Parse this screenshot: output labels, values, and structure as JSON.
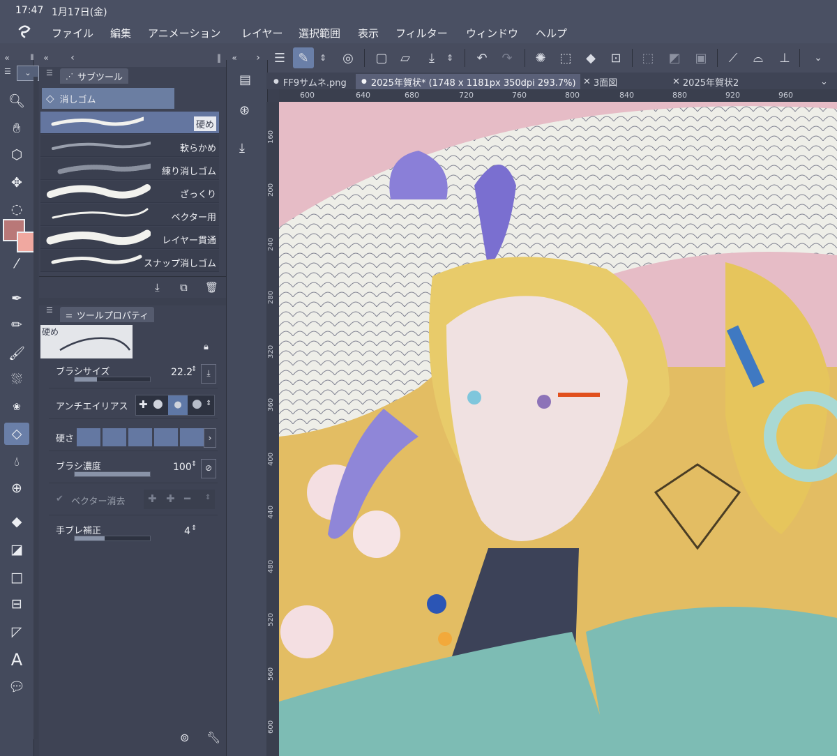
{
  "status": {
    "time": "17:47",
    "date": "1月17日(金)"
  },
  "menu": [
    "ファイル",
    "編集",
    "アニメーション",
    "レイヤー",
    "選択範囲",
    "表示",
    "フィルター",
    "ウィンドウ",
    "ヘルプ"
  ],
  "tabs": [
    {
      "label": "FF9サムネ.png",
      "active": false
    },
    {
      "label": "2025年賀状* (1748 x 1181px 350dpi 293.7%)",
      "active": true
    },
    {
      "label": "3面図",
      "active": false
    },
    {
      "label": "2025年賀状2",
      "active": false
    }
  ],
  "subtool_panel": {
    "title": "サブツール",
    "group": "消しゴム",
    "brushes": [
      "硬め",
      "軟らかめ",
      "練り消しゴム",
      "ざっくり",
      "ベクター用",
      "レイヤー貫通",
      "スナップ消しゴム"
    ],
    "selected_brush": "硬め"
  },
  "tool_property": {
    "title": "ツールプロパティ",
    "preview_label": "硬め",
    "brush_size_label": "ブラシサイズ",
    "brush_size_value": "22.2",
    "brush_size_fraction": 0.3,
    "antialias_label": "アンチエイリアス",
    "hardness_label": "硬さ",
    "density_label": "ブラシ濃度",
    "density_value": "100",
    "density_fraction": 1.0,
    "vector_erase_label": "ベクター消去",
    "stabilization_label": "手ブレ補正",
    "stabilization_value": "4",
    "stabilization_fraction": 0.4
  },
  "ruler": {
    "top": [
      "600",
      "640",
      "680",
      "720",
      "760",
      "800",
      "840",
      "880",
      "920",
      "960"
    ],
    "left": [
      "160",
      "200",
      "240",
      "280",
      "320",
      "360",
      "400",
      "440",
      "480",
      "520",
      "560",
      "600"
    ]
  },
  "colors": {
    "main": "#b97878",
    "sub": "#f0a8a0",
    "accent": "#6a7fa8"
  },
  "icons": {
    "tools": [
      "zoom-icon",
      "hand-icon",
      "object-select-icon",
      "move-icon",
      "lasso-icon",
      "magic-wand-icon",
      "eyedropper-icon",
      "pen-icon",
      "pencil-icon",
      "brush-icon",
      "airbrush-icon",
      "decoration-icon",
      "eraser-icon",
      "blend-icon",
      "figure-icon",
      "fill-icon",
      "gradient-icon",
      "rectangle-icon",
      "frame-icon",
      "ruler-icon",
      "text-icon",
      "balloon-icon"
    ]
  }
}
